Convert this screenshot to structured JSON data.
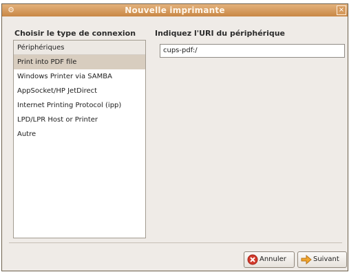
{
  "window": {
    "title": "Nouvelle imprimante"
  },
  "left_panel": {
    "heading": "Choisir le type de connexion",
    "items": [
      "Périphériques",
      "Print into PDF file",
      "Windows Printer via SAMBA",
      "AppSocket/HP JetDirect",
      "Internet Printing Protocol (ipp)",
      "LPD/LPR Host or Printer",
      "Autre"
    ],
    "selected_index": 1
  },
  "right_panel": {
    "heading": "Indiquez l'URI du périphérique",
    "uri_value": "cups-pdf:/"
  },
  "buttons": {
    "cancel_label": "Annuler",
    "next_label": "Suivant"
  },
  "colors": {
    "titlebar": "#c88745",
    "selection": "#d8cdbf",
    "cancel_icon": "#d33a2c",
    "next_icon": "#f1a52d"
  }
}
